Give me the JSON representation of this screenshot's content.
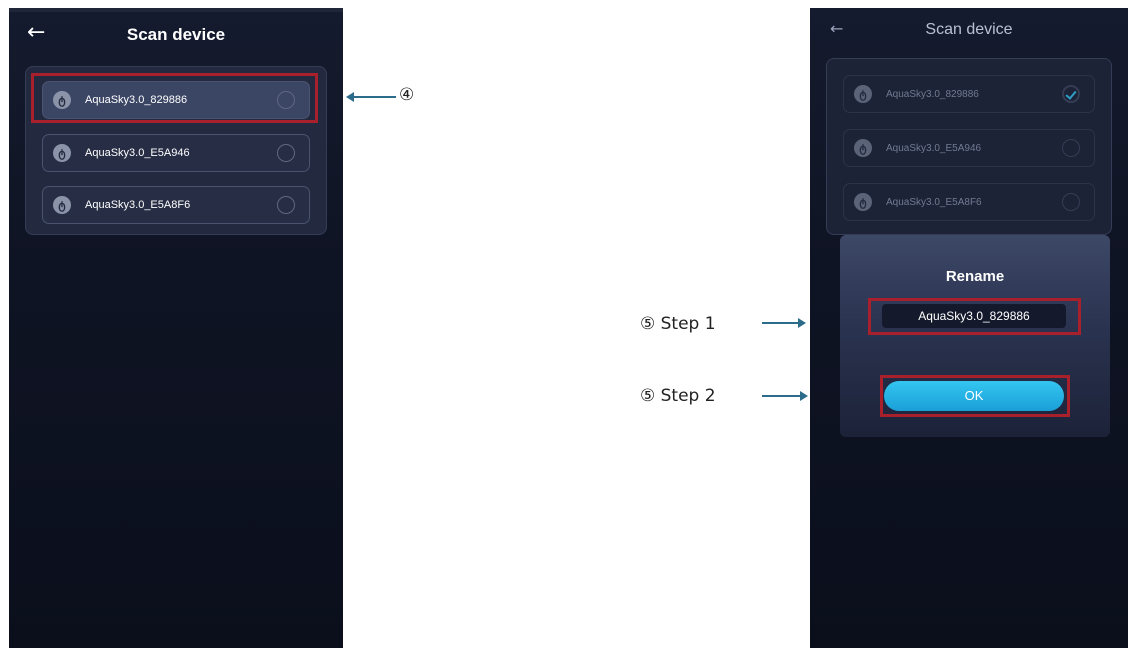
{
  "left_screen": {
    "title": "Scan device",
    "back_icon": "←",
    "devices": [
      {
        "name": "AquaSky3.0_829886",
        "selected": true
      },
      {
        "name": "AquaSky3.0_E5A946",
        "selected": false
      },
      {
        "name": "AquaSky3.0_E5A8F6",
        "selected": false
      }
    ]
  },
  "right_screen": {
    "title": "Scan device",
    "back_icon": "←",
    "devices": [
      {
        "name": "AquaSky3.0_829886",
        "checked": true
      },
      {
        "name": "AquaSky3.0_E5A946",
        "checked": false
      },
      {
        "name": "AquaSky3.0_E5A8F6",
        "checked": false
      }
    ],
    "dialog": {
      "title": "Rename",
      "input_value": "AquaSky3.0_829886",
      "ok_label": "OK"
    }
  },
  "annotations": {
    "step4": "④",
    "step5_1": "⑤ Step 1",
    "step5_2": "⑤ Step 2"
  },
  "colors": {
    "highlight": "#a8202c",
    "accent": "#1a9fd7",
    "arrow": "#2d6b8a"
  }
}
